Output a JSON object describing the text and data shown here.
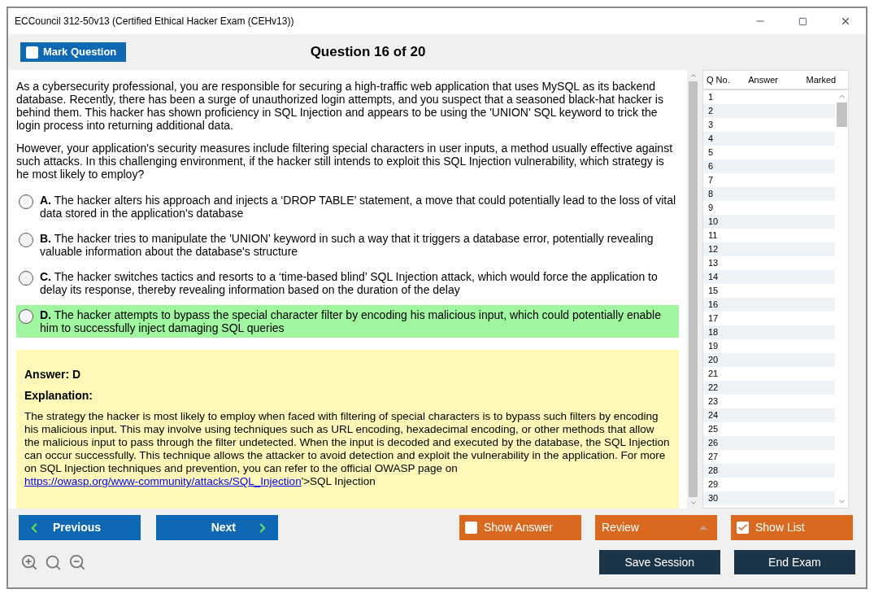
{
  "window": {
    "title": "ECCouncil 312-50v13 (Certified Ethical Hacker Exam (CEHv13))"
  },
  "header": {
    "mark_question": {
      "label": "Mark Question",
      "checked": false
    },
    "title": "Question 16 of 20"
  },
  "question": {
    "paragraphs": [
      "As a cybersecurity professional, you are responsible for securing a high-traffic web application that uses MySQL as its backend database. Recently, there has been a surge of unauthorized login attempts, and you suspect that a seasoned black-hat hacker is behind them. This hacker has shown proficiency in SQL Injection and appears to be using the 'UNION' SQL keyword to trick the login process into returning additional data.",
      "However, your application's security measures include filtering special characters in user inputs, a method usually effective against such attacks. In this challenging environment, if the hacker still intends to exploit this SQL Injection vulnerability, which strategy is he most likely to employ?"
    ],
    "options": [
      {
        "letter": "A.",
        "text": "The hacker alters his approach and injects a ‘DROP TABLE’ statement, a move that could potentially lead to the loss of vital data stored in the application's database",
        "selected": false,
        "correct": false
      },
      {
        "letter": "B.",
        "text": "The hacker tries to manipulate the 'UNION' keyword in such a way that it triggers a database error, potentially revealing valuable information about the database's structure",
        "selected": false,
        "correct": false
      },
      {
        "letter": "C.",
        "text": "The hacker switches tactics and resorts to a ‘time-based blind’ SQL Injection attack, which would force the application to delay its response, thereby revealing information based on the duration of the delay",
        "selected": false,
        "correct": false
      },
      {
        "letter": "D.",
        "text": "The hacker attempts to bypass the special character filter by encoding his malicious input, which could potentially enable him to successfully inject damaging SQL queries",
        "selected": false,
        "correct": true
      }
    ]
  },
  "answer": {
    "answer_line": "Answer: D",
    "explanation_heading": "Explanation:",
    "explanation": "The strategy the hacker is most likely to employ when faced with filtering of special characters is to bypass such filters by encoding his malicious input. This may involve using techniques such as URL encoding, hexadecimal encoding, or other methods that allow the malicious input to pass through the filter undetected. When the input is decoded and executed by the database, the SQL Injection can occur successfully. This technique allows the attacker to avoid detection and exploit the vulnerability in the application. For more on SQL Injection techniques and prevention, you can refer to the official OWASP page on ",
    "link": "https://owasp.org/www-community/attacks/SQL_Injection",
    "after_link": "'>SQL Injection"
  },
  "question_list": {
    "columns": [
      "Q No.",
      "Answer",
      "Marked"
    ],
    "rows": [
      "1",
      "2",
      "3",
      "4",
      "5",
      "6",
      "7",
      "8",
      "9",
      "10",
      "11",
      "12",
      "13",
      "14",
      "15",
      "16",
      "17",
      "18",
      "19",
      "20",
      "21",
      "22",
      "23",
      "24",
      "25",
      "26",
      "27",
      "28",
      "29",
      "30"
    ]
  },
  "footer": {
    "previous": "Previous",
    "next": "Next",
    "show_answer": {
      "label": "Show Answer",
      "checked": false
    },
    "review": "Review",
    "show_list": {
      "label": "Show List",
      "checked": true
    },
    "save_session": "Save Session",
    "end_exam": "End Exam"
  }
}
